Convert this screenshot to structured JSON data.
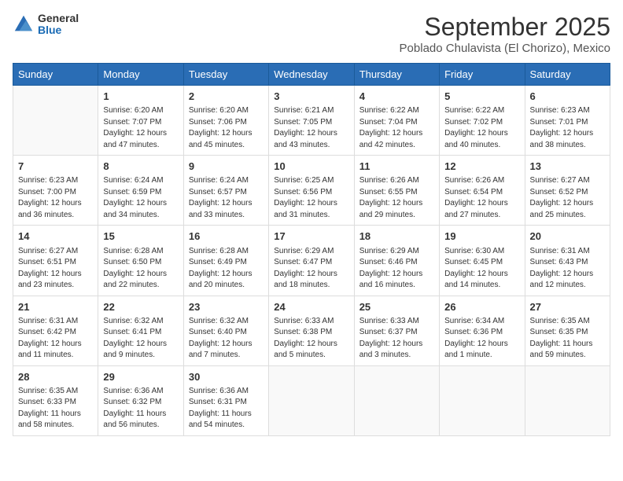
{
  "header": {
    "logo": {
      "general": "General",
      "blue": "Blue"
    },
    "title": "September 2025",
    "subtitle": "Poblado Chulavista (El Chorizo), Mexico"
  },
  "weekdays": [
    "Sunday",
    "Monday",
    "Tuesday",
    "Wednesday",
    "Thursday",
    "Friday",
    "Saturday"
  ],
  "weeks": [
    [
      {
        "day": "",
        "sunrise": "",
        "sunset": "",
        "daylight": ""
      },
      {
        "day": "1",
        "sunrise": "Sunrise: 6:20 AM",
        "sunset": "Sunset: 7:07 PM",
        "daylight": "Daylight: 12 hours and 47 minutes."
      },
      {
        "day": "2",
        "sunrise": "Sunrise: 6:20 AM",
        "sunset": "Sunset: 7:06 PM",
        "daylight": "Daylight: 12 hours and 45 minutes."
      },
      {
        "day": "3",
        "sunrise": "Sunrise: 6:21 AM",
        "sunset": "Sunset: 7:05 PM",
        "daylight": "Daylight: 12 hours and 43 minutes."
      },
      {
        "day": "4",
        "sunrise": "Sunrise: 6:22 AM",
        "sunset": "Sunset: 7:04 PM",
        "daylight": "Daylight: 12 hours and 42 minutes."
      },
      {
        "day": "5",
        "sunrise": "Sunrise: 6:22 AM",
        "sunset": "Sunset: 7:02 PM",
        "daylight": "Daylight: 12 hours and 40 minutes."
      },
      {
        "day": "6",
        "sunrise": "Sunrise: 6:23 AM",
        "sunset": "Sunset: 7:01 PM",
        "daylight": "Daylight: 12 hours and 38 minutes."
      }
    ],
    [
      {
        "day": "7",
        "sunrise": "Sunrise: 6:23 AM",
        "sunset": "Sunset: 7:00 PM",
        "daylight": "Daylight: 12 hours and 36 minutes."
      },
      {
        "day": "8",
        "sunrise": "Sunrise: 6:24 AM",
        "sunset": "Sunset: 6:59 PM",
        "daylight": "Daylight: 12 hours and 34 minutes."
      },
      {
        "day": "9",
        "sunrise": "Sunrise: 6:24 AM",
        "sunset": "Sunset: 6:57 PM",
        "daylight": "Daylight: 12 hours and 33 minutes."
      },
      {
        "day": "10",
        "sunrise": "Sunrise: 6:25 AM",
        "sunset": "Sunset: 6:56 PM",
        "daylight": "Daylight: 12 hours and 31 minutes."
      },
      {
        "day": "11",
        "sunrise": "Sunrise: 6:26 AM",
        "sunset": "Sunset: 6:55 PM",
        "daylight": "Daylight: 12 hours and 29 minutes."
      },
      {
        "day": "12",
        "sunrise": "Sunrise: 6:26 AM",
        "sunset": "Sunset: 6:54 PM",
        "daylight": "Daylight: 12 hours and 27 minutes."
      },
      {
        "day": "13",
        "sunrise": "Sunrise: 6:27 AM",
        "sunset": "Sunset: 6:52 PM",
        "daylight": "Daylight: 12 hours and 25 minutes."
      }
    ],
    [
      {
        "day": "14",
        "sunrise": "Sunrise: 6:27 AM",
        "sunset": "Sunset: 6:51 PM",
        "daylight": "Daylight: 12 hours and 23 minutes."
      },
      {
        "day": "15",
        "sunrise": "Sunrise: 6:28 AM",
        "sunset": "Sunset: 6:50 PM",
        "daylight": "Daylight: 12 hours and 22 minutes."
      },
      {
        "day": "16",
        "sunrise": "Sunrise: 6:28 AM",
        "sunset": "Sunset: 6:49 PM",
        "daylight": "Daylight: 12 hours and 20 minutes."
      },
      {
        "day": "17",
        "sunrise": "Sunrise: 6:29 AM",
        "sunset": "Sunset: 6:47 PM",
        "daylight": "Daylight: 12 hours and 18 minutes."
      },
      {
        "day": "18",
        "sunrise": "Sunrise: 6:29 AM",
        "sunset": "Sunset: 6:46 PM",
        "daylight": "Daylight: 12 hours and 16 minutes."
      },
      {
        "day": "19",
        "sunrise": "Sunrise: 6:30 AM",
        "sunset": "Sunset: 6:45 PM",
        "daylight": "Daylight: 12 hours and 14 minutes."
      },
      {
        "day": "20",
        "sunrise": "Sunrise: 6:31 AM",
        "sunset": "Sunset: 6:43 PM",
        "daylight": "Daylight: 12 hours and 12 minutes."
      }
    ],
    [
      {
        "day": "21",
        "sunrise": "Sunrise: 6:31 AM",
        "sunset": "Sunset: 6:42 PM",
        "daylight": "Daylight: 12 hours and 11 minutes."
      },
      {
        "day": "22",
        "sunrise": "Sunrise: 6:32 AM",
        "sunset": "Sunset: 6:41 PM",
        "daylight": "Daylight: 12 hours and 9 minutes."
      },
      {
        "day": "23",
        "sunrise": "Sunrise: 6:32 AM",
        "sunset": "Sunset: 6:40 PM",
        "daylight": "Daylight: 12 hours and 7 minutes."
      },
      {
        "day": "24",
        "sunrise": "Sunrise: 6:33 AM",
        "sunset": "Sunset: 6:38 PM",
        "daylight": "Daylight: 12 hours and 5 minutes."
      },
      {
        "day": "25",
        "sunrise": "Sunrise: 6:33 AM",
        "sunset": "Sunset: 6:37 PM",
        "daylight": "Daylight: 12 hours and 3 minutes."
      },
      {
        "day": "26",
        "sunrise": "Sunrise: 6:34 AM",
        "sunset": "Sunset: 6:36 PM",
        "daylight": "Daylight: 12 hours and 1 minute."
      },
      {
        "day": "27",
        "sunrise": "Sunrise: 6:35 AM",
        "sunset": "Sunset: 6:35 PM",
        "daylight": "Daylight: 11 hours and 59 minutes."
      }
    ],
    [
      {
        "day": "28",
        "sunrise": "Sunrise: 6:35 AM",
        "sunset": "Sunset: 6:33 PM",
        "daylight": "Daylight: 11 hours and 58 minutes."
      },
      {
        "day": "29",
        "sunrise": "Sunrise: 6:36 AM",
        "sunset": "Sunset: 6:32 PM",
        "daylight": "Daylight: 11 hours and 56 minutes."
      },
      {
        "day": "30",
        "sunrise": "Sunrise: 6:36 AM",
        "sunset": "Sunset: 6:31 PM",
        "daylight": "Daylight: 11 hours and 54 minutes."
      },
      {
        "day": "",
        "sunrise": "",
        "sunset": "",
        "daylight": ""
      },
      {
        "day": "",
        "sunrise": "",
        "sunset": "",
        "daylight": ""
      },
      {
        "day": "",
        "sunrise": "",
        "sunset": "",
        "daylight": ""
      },
      {
        "day": "",
        "sunrise": "",
        "sunset": "",
        "daylight": ""
      }
    ]
  ]
}
